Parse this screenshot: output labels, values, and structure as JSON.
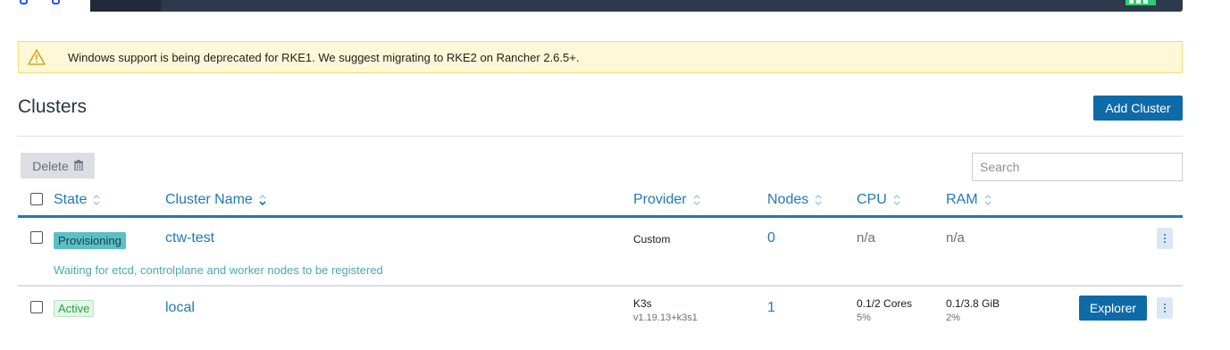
{
  "banner": {
    "text": "Windows support is being deprecated for RKE1. We suggest migrating to RKE2 on Rancher 2.6.5+."
  },
  "header": {
    "title": "Clusters",
    "add_button": "Add Cluster"
  },
  "toolbar": {
    "delete_label": "Delete",
    "search_placeholder": "Search"
  },
  "table": {
    "columns": [
      "State",
      "Cluster Name",
      "Provider",
      "Nodes",
      "CPU",
      "RAM"
    ],
    "rows": [
      {
        "state": "Provisioning",
        "name": "ctw-test",
        "provider": "Custom",
        "provider_version": "",
        "nodes": "0",
        "cpu": "n/a",
        "cpu_pct": "",
        "ram": "n/a",
        "ram_pct": "",
        "message": "Waiting for etcd, controlplane and worker nodes to be registered"
      },
      {
        "state": "Active",
        "name": "local",
        "provider": "K3s",
        "provider_version": "v1.19.13+k3s1",
        "nodes": "1",
        "cpu": "0.1/2 Cores",
        "cpu_pct": "5%",
        "ram": "0.1/3.8 GiB",
        "ram_pct": "2%",
        "action_button": "Explorer"
      }
    ]
  },
  "colors": {
    "accent": "#1f79b8",
    "primary_button": "#0f6aa8",
    "warning_bg": "#fdf8d7",
    "provisioning": "#5bbfc7",
    "active": "#2e9e4a"
  }
}
